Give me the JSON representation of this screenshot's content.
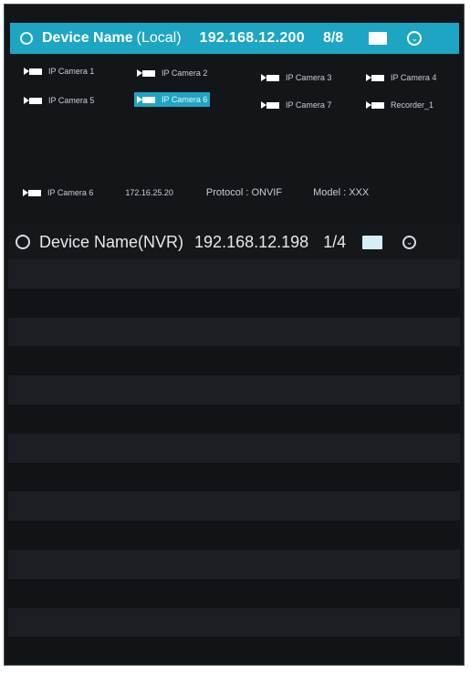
{
  "local_device": {
    "name": "Device Name",
    "type": "(Local)",
    "ip": "192.168.12.200",
    "count": "8/8",
    "icons": {
      "radio": "radio-icon",
      "screen": "monitor-icon",
      "expand": "chevron-circle-icon"
    },
    "cameras": [
      {
        "label": "IP Camera 1",
        "selected": false
      },
      {
        "label": "IP Camera 2",
        "selected": false
      },
      {
        "label": "IP Camera 3",
        "selected": false
      },
      {
        "label": "IP Camera 4",
        "selected": false
      },
      {
        "label": "IP Camera 5",
        "selected": false
      },
      {
        "label": "IP Camera 6",
        "selected": true
      },
      {
        "label": "IP Camera 7",
        "selected": false
      },
      {
        "label": "Recorder_1",
        "selected": false
      }
    ],
    "detail": {
      "camera": "IP Camera 6",
      "ip": "172.16.25.20",
      "protocol": "Protocol : ONVIF",
      "model": "Model : XXX"
    }
  },
  "nvr_device": {
    "name": "Device Name(NVR)",
    "ip": "192.168.12.198",
    "count": "1/4"
  },
  "colors": {
    "accent": "#1fa5c4",
    "panel_bg": "#131619",
    "row_a": "#1b1f23",
    "row_b": "#111417"
  }
}
